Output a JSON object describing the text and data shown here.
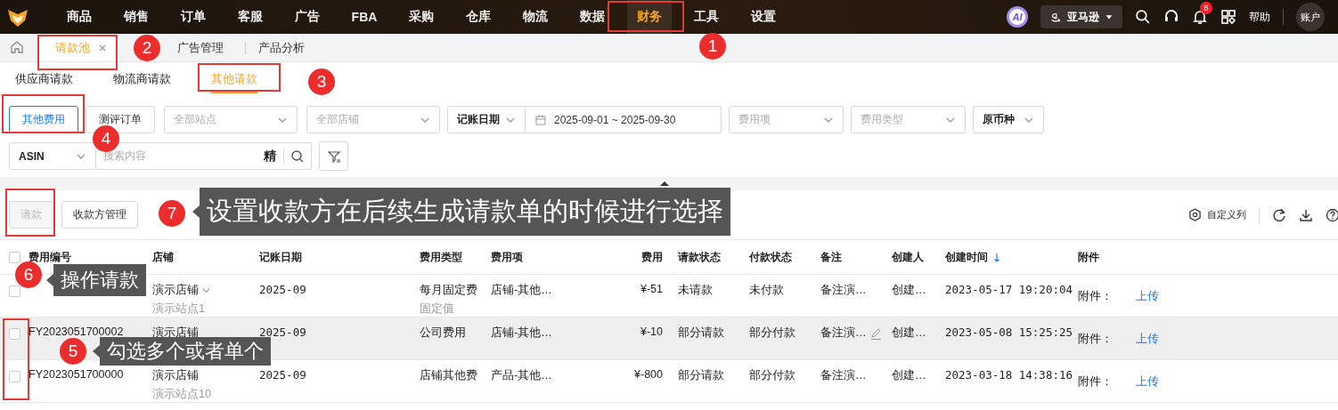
{
  "nav": {
    "items": [
      {
        "label": "商品",
        "selected": false
      },
      {
        "label": "销售",
        "selected": false
      },
      {
        "label": "订单",
        "selected": false
      },
      {
        "label": "客服",
        "selected": false
      },
      {
        "label": "广告",
        "selected": false
      },
      {
        "label": "FBA",
        "selected": false
      },
      {
        "label": "采购",
        "selected": false
      },
      {
        "label": "仓库",
        "selected": false
      },
      {
        "label": "物流",
        "selected": false
      },
      {
        "label": "数据",
        "selected": false
      },
      {
        "label": "财务",
        "selected": true
      },
      {
        "label": "工具",
        "selected": false
      },
      {
        "label": "设置",
        "selected": false
      }
    ],
    "ai_badge": "AI",
    "marketplace": "亚马逊",
    "notification_count": "8",
    "help": "帮助",
    "account": "账户"
  },
  "page_tabs": [
    {
      "label": "请款池",
      "selected": true,
      "closable": true
    },
    {
      "label": "广告管理",
      "selected": false,
      "closable": false
    },
    {
      "label": "产品分析",
      "selected": false,
      "closable": false
    }
  ],
  "sub_tabs": [
    {
      "label": "供应商请款",
      "selected": false
    },
    {
      "label": "物流商请款",
      "selected": false
    },
    {
      "label": "其他请款",
      "selected": true
    }
  ],
  "filters": {
    "type_buttons": [
      {
        "label": "其他费用",
        "selected": true
      },
      {
        "label": "测评订单",
        "selected": false
      }
    ],
    "site_select": {
      "placeholder": "全部站点"
    },
    "store_select": {
      "placeholder": "全部店铺"
    },
    "date_type_select": {
      "value": "记账日期"
    },
    "date_range": {
      "start": "2025-09-01",
      "separator": "~",
      "end": "2025-09-30"
    },
    "fee_item_select": {
      "placeholder": "费用项"
    },
    "fee_type_select": {
      "placeholder": "费用类型"
    },
    "currency_select": {
      "value": "原币种"
    },
    "search_field_select": {
      "value": "ASIN"
    },
    "search": {
      "placeholder": "搜索内容",
      "exact_label": "精"
    }
  },
  "toolbar": {
    "buttons": [
      {
        "label": "请款",
        "disabled": true
      },
      {
        "label": "收款方管理",
        "disabled": false
      }
    ],
    "custom_columns": "自定义列"
  },
  "table": {
    "select_all_checked": false,
    "columns": [
      {
        "label": "费用编号"
      },
      {
        "label": "店铺"
      },
      {
        "label": "记账日期"
      },
      {
        "label": "费用类型"
      },
      {
        "label": "费用项"
      },
      {
        "label": "费用"
      },
      {
        "label": "请款状态"
      },
      {
        "label": "付款状态"
      },
      {
        "label": "备注"
      },
      {
        "label": "创建人"
      },
      {
        "label": "创建时间",
        "sorted": true
      },
      {
        "label": "附件"
      }
    ],
    "rows": [
      {
        "checked": false,
        "hovered": false,
        "store": "演示店铺",
        "store_dropdown": true,
        "site": "演示站点1",
        "date": "2025-09",
        "fee_type": "每月固定费",
        "fee_type_sub": "固定值",
        "fee_item": "店铺-其他…",
        "fee": "¥-51",
        "request_status": "未请款",
        "payment_status": "未付款",
        "note": "备注演…",
        "note_editable": false,
        "creator": "创建…",
        "created": "2023-05-17 19:20:04",
        "attachment_label": "附件：",
        "upload": "上传"
      },
      {
        "checked": false,
        "hovered": true,
        "id": "FY2023051700002",
        "store": "演示店铺",
        "store_dropdown": false,
        "date": "2025-09",
        "fee_type": "公司费用",
        "fee_item": "店铺-其他…",
        "fee": "¥-10",
        "request_status": "部分请款",
        "payment_status": "部分付款",
        "note": "备注演…",
        "note_editable": true,
        "creator": "创建…",
        "created": "2023-05-08 15:25:25",
        "attachment_label": "附件：",
        "upload": "上传"
      },
      {
        "checked": false,
        "hovered": false,
        "id": "FY2023051700000",
        "store": "演示店铺",
        "store_dropdown": false,
        "site": "演示站点10",
        "date": "2025-09",
        "fee_type": "店铺其他费",
        "fee_item": "产品-其他…",
        "fee": "¥-800",
        "request_status": "部分请款",
        "payment_status": "部分付款",
        "note": "备注演…",
        "note_editable": false,
        "creator": "创建…",
        "created": "2023-03-18 14:38:16",
        "attachment_label": "附件：",
        "upload": "上传"
      }
    ]
  },
  "annotations": [
    {
      "number": "1"
    },
    {
      "number": "2"
    },
    {
      "number": "3"
    },
    {
      "number": "4"
    },
    {
      "number": "5",
      "text": "勾选多个或者单个"
    },
    {
      "number": "6",
      "text": "操作请款"
    },
    {
      "number": "7",
      "text": "设置收款方在后续生成请款单的时候进行选择"
    }
  ]
}
